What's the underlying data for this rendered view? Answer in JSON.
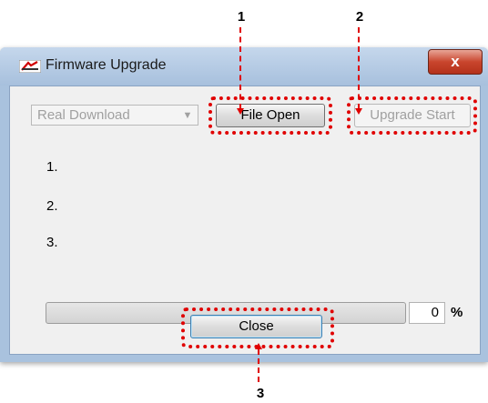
{
  "callouts": [
    {
      "num": "1"
    },
    {
      "num": "2"
    },
    {
      "num": "3"
    }
  ],
  "window": {
    "title": "Firmware Upgrade",
    "close_glyph": "x"
  },
  "toolbar": {
    "mode_select_value": "Real Download",
    "file_open_label": "File Open",
    "upgrade_start_label": "Upgrade Start"
  },
  "steps": [
    "1.",
    "2.",
    "3."
  ],
  "progress": {
    "value": "0",
    "fraction": 0,
    "unit": "%"
  },
  "footer": {
    "close_label": "Close"
  },
  "colors": {
    "annotation_red": "#e00000",
    "title_bar": "#a9c2de",
    "client_bg": "#f0f0f0"
  }
}
